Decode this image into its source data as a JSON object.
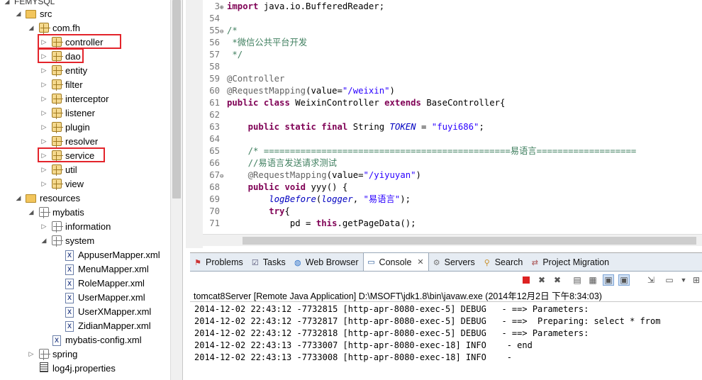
{
  "explorer": {
    "project_title": "FEMYSQL",
    "items": [
      {
        "label": "src",
        "kind": "folder-src",
        "depth": 1,
        "expanded": true
      },
      {
        "label": "com.fh",
        "kind": "package",
        "depth": 2,
        "expanded": true
      },
      {
        "label": "controller",
        "kind": "package",
        "depth": 3,
        "expanded": false,
        "highlighted": true
      },
      {
        "label": "dao",
        "kind": "package",
        "depth": 3,
        "expanded": false,
        "highlighted": true
      },
      {
        "label": "entity",
        "kind": "package",
        "depth": 3,
        "expanded": false
      },
      {
        "label": "filter",
        "kind": "package",
        "depth": 3,
        "expanded": false
      },
      {
        "label": "interceptor",
        "kind": "package",
        "depth": 3,
        "expanded": false
      },
      {
        "label": "listener",
        "kind": "package",
        "depth": 3,
        "expanded": false
      },
      {
        "label": "plugin",
        "kind": "package",
        "depth": 3,
        "expanded": false
      },
      {
        "label": "resolver",
        "kind": "package",
        "depth": 3,
        "expanded": false
      },
      {
        "label": "service",
        "kind": "package",
        "depth": 3,
        "expanded": false,
        "highlighted": true
      },
      {
        "label": "util",
        "kind": "package",
        "depth": 3,
        "expanded": false
      },
      {
        "label": "view",
        "kind": "package",
        "depth": 3,
        "expanded": false
      },
      {
        "label": "resources",
        "kind": "folder",
        "depth": 1,
        "expanded": true
      },
      {
        "label": "mybatis",
        "kind": "package-white",
        "depth": 2,
        "expanded": true
      },
      {
        "label": "information",
        "kind": "package-white",
        "depth": 3,
        "expanded": false
      },
      {
        "label": "system",
        "kind": "package-white",
        "depth": 3,
        "expanded": true
      },
      {
        "label": "AppuserMapper.xml",
        "kind": "xml",
        "depth": 4
      },
      {
        "label": "MenuMapper.xml",
        "kind": "xml",
        "depth": 4
      },
      {
        "label": "RoleMapper.xml",
        "kind": "xml",
        "depth": 4
      },
      {
        "label": "UserMapper.xml",
        "kind": "xml",
        "depth": 4
      },
      {
        "label": "UserXMapper.xml",
        "kind": "xml",
        "depth": 4
      },
      {
        "label": "ZidianMapper.xml",
        "kind": "xml",
        "depth": 4
      },
      {
        "label": "mybatis-config.xml",
        "kind": "xml",
        "depth": 3
      },
      {
        "label": "spring",
        "kind": "package-white",
        "depth": 2,
        "expanded": false
      },
      {
        "label": "log4j.properties",
        "kind": "properties",
        "depth": 2
      }
    ]
  },
  "editor": {
    "lines": [
      {
        "n": "3",
        "fold": "⊕",
        "segs": [
          [
            "kw",
            "import"
          ],
          [
            "code",
            " java.io.BufferedReader;"
          ]
        ]
      },
      {
        "n": "54",
        "fold": "",
        "segs": []
      },
      {
        "n": "55",
        "fold": "⊖",
        "segs": [
          [
            "cm",
            "/*"
          ]
        ]
      },
      {
        "n": "56",
        "fold": "",
        "segs": [
          [
            "cm",
            " *微信公共平台开发"
          ]
        ]
      },
      {
        "n": "57",
        "fold": "",
        "segs": [
          [
            "cm",
            " */"
          ]
        ]
      },
      {
        "n": "58",
        "fold": "",
        "segs": []
      },
      {
        "n": "59",
        "fold": "",
        "segs": [
          [
            "an",
            "@Controller"
          ]
        ]
      },
      {
        "n": "60",
        "fold": "",
        "segs": [
          [
            "an",
            "@RequestMapping"
          ],
          [
            "code",
            "(value="
          ],
          [
            "st",
            "\"/weixin\""
          ],
          [
            "code",
            ")"
          ]
        ]
      },
      {
        "n": "61",
        "fold": "",
        "segs": [
          [
            "kw",
            "public"
          ],
          [
            "code",
            " "
          ],
          [
            "kw",
            "class"
          ],
          [
            "code",
            " WeixinController "
          ],
          [
            "kw",
            "extends"
          ],
          [
            "code",
            " BaseController{"
          ]
        ]
      },
      {
        "n": "62",
        "fold": "",
        "segs": []
      },
      {
        "n": "63",
        "fold": "",
        "segs": [
          [
            "code",
            "    "
          ],
          [
            "kw",
            "public"
          ],
          [
            "code",
            " "
          ],
          [
            "kw",
            "static"
          ],
          [
            "code",
            " "
          ],
          [
            "kw",
            "final"
          ],
          [
            "code",
            " String "
          ],
          [
            "it",
            "TOKEN"
          ],
          [
            "code",
            " = "
          ],
          [
            "st",
            "\"fuyi686\""
          ],
          [
            "code",
            ";"
          ]
        ]
      },
      {
        "n": "64",
        "fold": "",
        "segs": []
      },
      {
        "n": "65",
        "fold": "",
        "segs": [
          [
            "cm",
            "    /* ===============================================易语言==================="
          ]
        ]
      },
      {
        "n": "66",
        "fold": "",
        "segs": [
          [
            "cm",
            "    //易语言发送请求测试"
          ]
        ]
      },
      {
        "n": "67",
        "fold": "⊖",
        "segs": [
          [
            "an",
            "    @RequestMapping"
          ],
          [
            "code",
            "(value="
          ],
          [
            "st",
            "\"/yiyuyan\""
          ],
          [
            "code",
            ")"
          ]
        ]
      },
      {
        "n": "68",
        "fold": "",
        "segs": [
          [
            "code",
            "    "
          ],
          [
            "kw",
            "public"
          ],
          [
            "code",
            " "
          ],
          [
            "kw",
            "void"
          ],
          [
            "code",
            " yyy() {"
          ]
        ]
      },
      {
        "n": "69",
        "fold": "",
        "segs": [
          [
            "code",
            "        "
          ],
          [
            "it",
            "logBefore"
          ],
          [
            "code",
            "("
          ],
          [
            "it",
            "logger"
          ],
          [
            "code",
            ", "
          ],
          [
            "st",
            "\"易语言\""
          ],
          [
            "code",
            ");"
          ]
        ]
      },
      {
        "n": "70",
        "fold": "",
        "segs": [
          [
            "code",
            "        "
          ],
          [
            "kw",
            "try"
          ],
          [
            "code",
            "{"
          ]
        ]
      },
      {
        "n": "71",
        "fold": "",
        "segs": [
          [
            "code",
            "            pd = "
          ],
          [
            "kw",
            "this"
          ],
          [
            "code",
            ".getPageData();"
          ]
        ]
      }
    ]
  },
  "panel": {
    "tabs": [
      {
        "label": "Problems",
        "icon": "problems-icon",
        "active": false
      },
      {
        "label": "Tasks",
        "icon": "tasks-icon",
        "active": false
      },
      {
        "label": "Web Browser",
        "icon": "globe-icon",
        "active": false
      },
      {
        "label": "Console",
        "icon": "console-icon",
        "active": true
      },
      {
        "label": "Servers",
        "icon": "servers-icon",
        "active": false
      },
      {
        "label": "Search",
        "icon": "search-icon",
        "active": false
      },
      {
        "label": "Project Migration",
        "icon": "migration-icon",
        "active": false
      }
    ],
    "console_title": "tomcat8Server [Remote Java Application] D:\\MSOFT\\jdk1.8\\bin\\javaw.exe (2014年12月2日 下午8:34:03)",
    "log_lines": [
      "2014-12-02 22:43:12 -7732815 [http-apr-8080-exec-5] DEBUG   - ==> Parameters:",
      "2014-12-02 22:43:12 -7732817 [http-apr-8080-exec-5] DEBUG   - ==>  Preparing: select * from",
      "2014-12-02 22:43:12 -7732818 [http-apr-8080-exec-5] DEBUG   - ==> Parameters:",
      "2014-12-02 22:43:13 -7733007 [http-apr-8080-exec-18] INFO    - end",
      "2014-12-02 22:43:13 -7733008 [http-apr-8080-exec-18] INFO    -"
    ]
  },
  "colors": {
    "highlight_box": "#e3242b",
    "keyword": "#7f0055",
    "comment": "#3f7f5f",
    "string": "#2a00ff"
  }
}
